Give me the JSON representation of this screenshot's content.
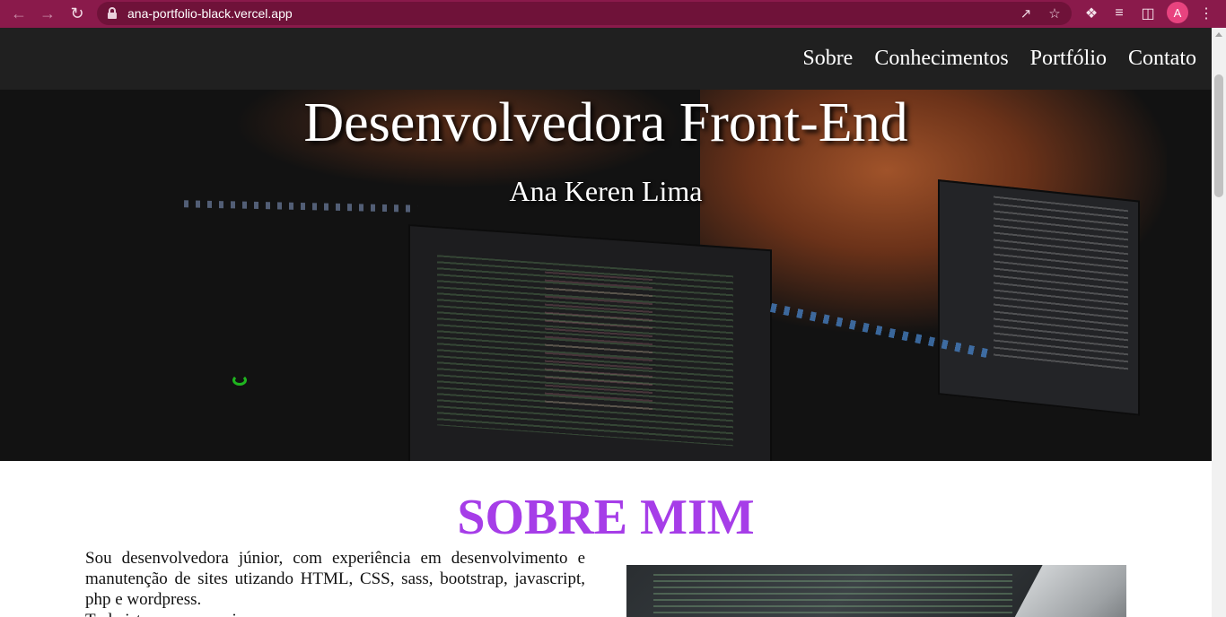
{
  "browser": {
    "url": "ana-portfolio-black.vercel.app",
    "profile_initial": "A",
    "accent_color": "#8a1a4b",
    "icons": {
      "back": "arrow-left-icon",
      "forward": "arrow-right-icon",
      "reload": "reload-icon",
      "lock": "lock-icon",
      "share": "share-icon",
      "bookmark": "star-icon",
      "extensions": "puzzle-icon",
      "media": "playlist-icon",
      "sidepanel": "sidepanel-icon",
      "menu": "kebab-menu-icon"
    }
  },
  "nav": {
    "items": [
      {
        "label": "Sobre"
      },
      {
        "label": "Conhecimentos"
      },
      {
        "label": "Portfólio"
      },
      {
        "label": "Contato"
      }
    ]
  },
  "hero": {
    "title": "Desenvolvedora Front-End",
    "subtitle": "Ana Keren Lima"
  },
  "about": {
    "title": "SOBRE MIM",
    "title_color": "#a63de8",
    "paragraph_1": "Sou desenvolvedora júnior, com experiência em desenvolvimento e manutenção de sites utizando HTML, CSS, sass, bootstrap, javascript, php e wordpress.",
    "paragraph_2": "Tudo isto me proporcionou..."
  }
}
